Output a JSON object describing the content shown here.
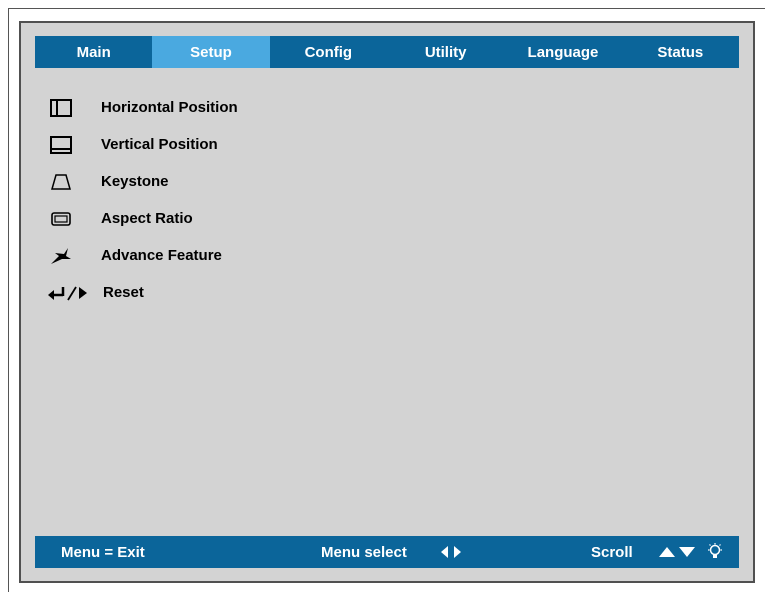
{
  "tabs": [
    "Main",
    "Setup",
    "Config",
    "Utility",
    "Language",
    "Status"
  ],
  "active_tab": "Setup",
  "menu_items": [
    {
      "label": "Horizontal Position",
      "icon": "horizontal-position-icon"
    },
    {
      "label": "Vertical Position",
      "icon": "vertical-position-icon"
    },
    {
      "label": "Keystone",
      "icon": "keystone-icon"
    },
    {
      "label": "Aspect Ratio",
      "icon": "aspect-ratio-icon"
    },
    {
      "label": "Advance Feature",
      "icon": "advance-feature-icon"
    },
    {
      "label": "Reset",
      "icon": "enter-right-arrow-icon"
    }
  ],
  "footer": {
    "exit_hint": "Menu = Exit",
    "select_hint": "Menu select",
    "scroll_hint": "Scroll",
    "select_icon": "left-right-arrows-icon",
    "scroll_icon": "up-down-arrows-icon",
    "extra_icon": "lightbulb-icon"
  },
  "colors": {
    "bar": "#0b659a",
    "active_tab": "#4aa9e0",
    "panel": "#d3d3d3"
  }
}
